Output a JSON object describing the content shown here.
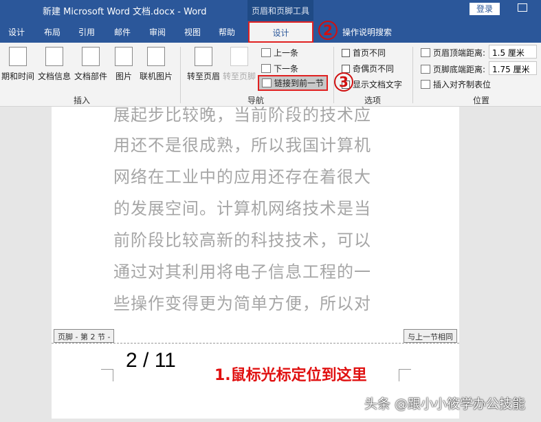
{
  "titlebar": {
    "title": "新建 Microsoft Word 文档.docx  -  Word",
    "context_tool": "页眉和页脚工具",
    "login": "登录"
  },
  "tabs": [
    "设计",
    "布局",
    "引用",
    "邮件",
    "审阅",
    "视图",
    "帮助"
  ],
  "active_tab": "设计",
  "search": "操作说明搜索",
  "ribbon": {
    "insert": {
      "items": [
        "期和时间",
        "文档信息",
        "文档部件",
        "图片",
        "联机图片"
      ],
      "group": "插入"
    },
    "nav": {
      "goto_header": "转至页眉",
      "goto_footer": "转至页脚",
      "prev": "上一条",
      "next": "下一条",
      "link": "链接到前一节",
      "group": "导航"
    },
    "options": {
      "first": "首页不同",
      "oddeven": "奇偶页不同",
      "show_text": "显示文档文字",
      "group": "选项"
    },
    "position": {
      "header_top": "页眉顶端距离:",
      "header_top_val": "1.5 厘米",
      "footer_bottom": "页脚底端距离:",
      "footer_bottom_val": "1.75 厘米",
      "align_tab": "插入对齐制表位",
      "group": "位置"
    }
  },
  "markers": {
    "two": "2",
    "three": "3"
  },
  "doc": {
    "lines": [
      "展起步比较晚，当前阶段的技术应",
      "用还不是很成熟，所以我国计算机",
      "网络在工业中的应用还存在着很大",
      "的发展空间。计算机网络技术是当",
      "前阶段比较高新的科技技术，可以",
      "通过对其利用将电子信息工程的一",
      "些操作变得更为简单方便，所以对"
    ],
    "footer_label": "页脚 - 第 2 节 -",
    "same_as_prev": "与上一节相同",
    "page_number": "2 / 11",
    "annotation": "1.鼠标光标定位到这里"
  },
  "watermark": "头条 @跟小小筱学办公技能"
}
